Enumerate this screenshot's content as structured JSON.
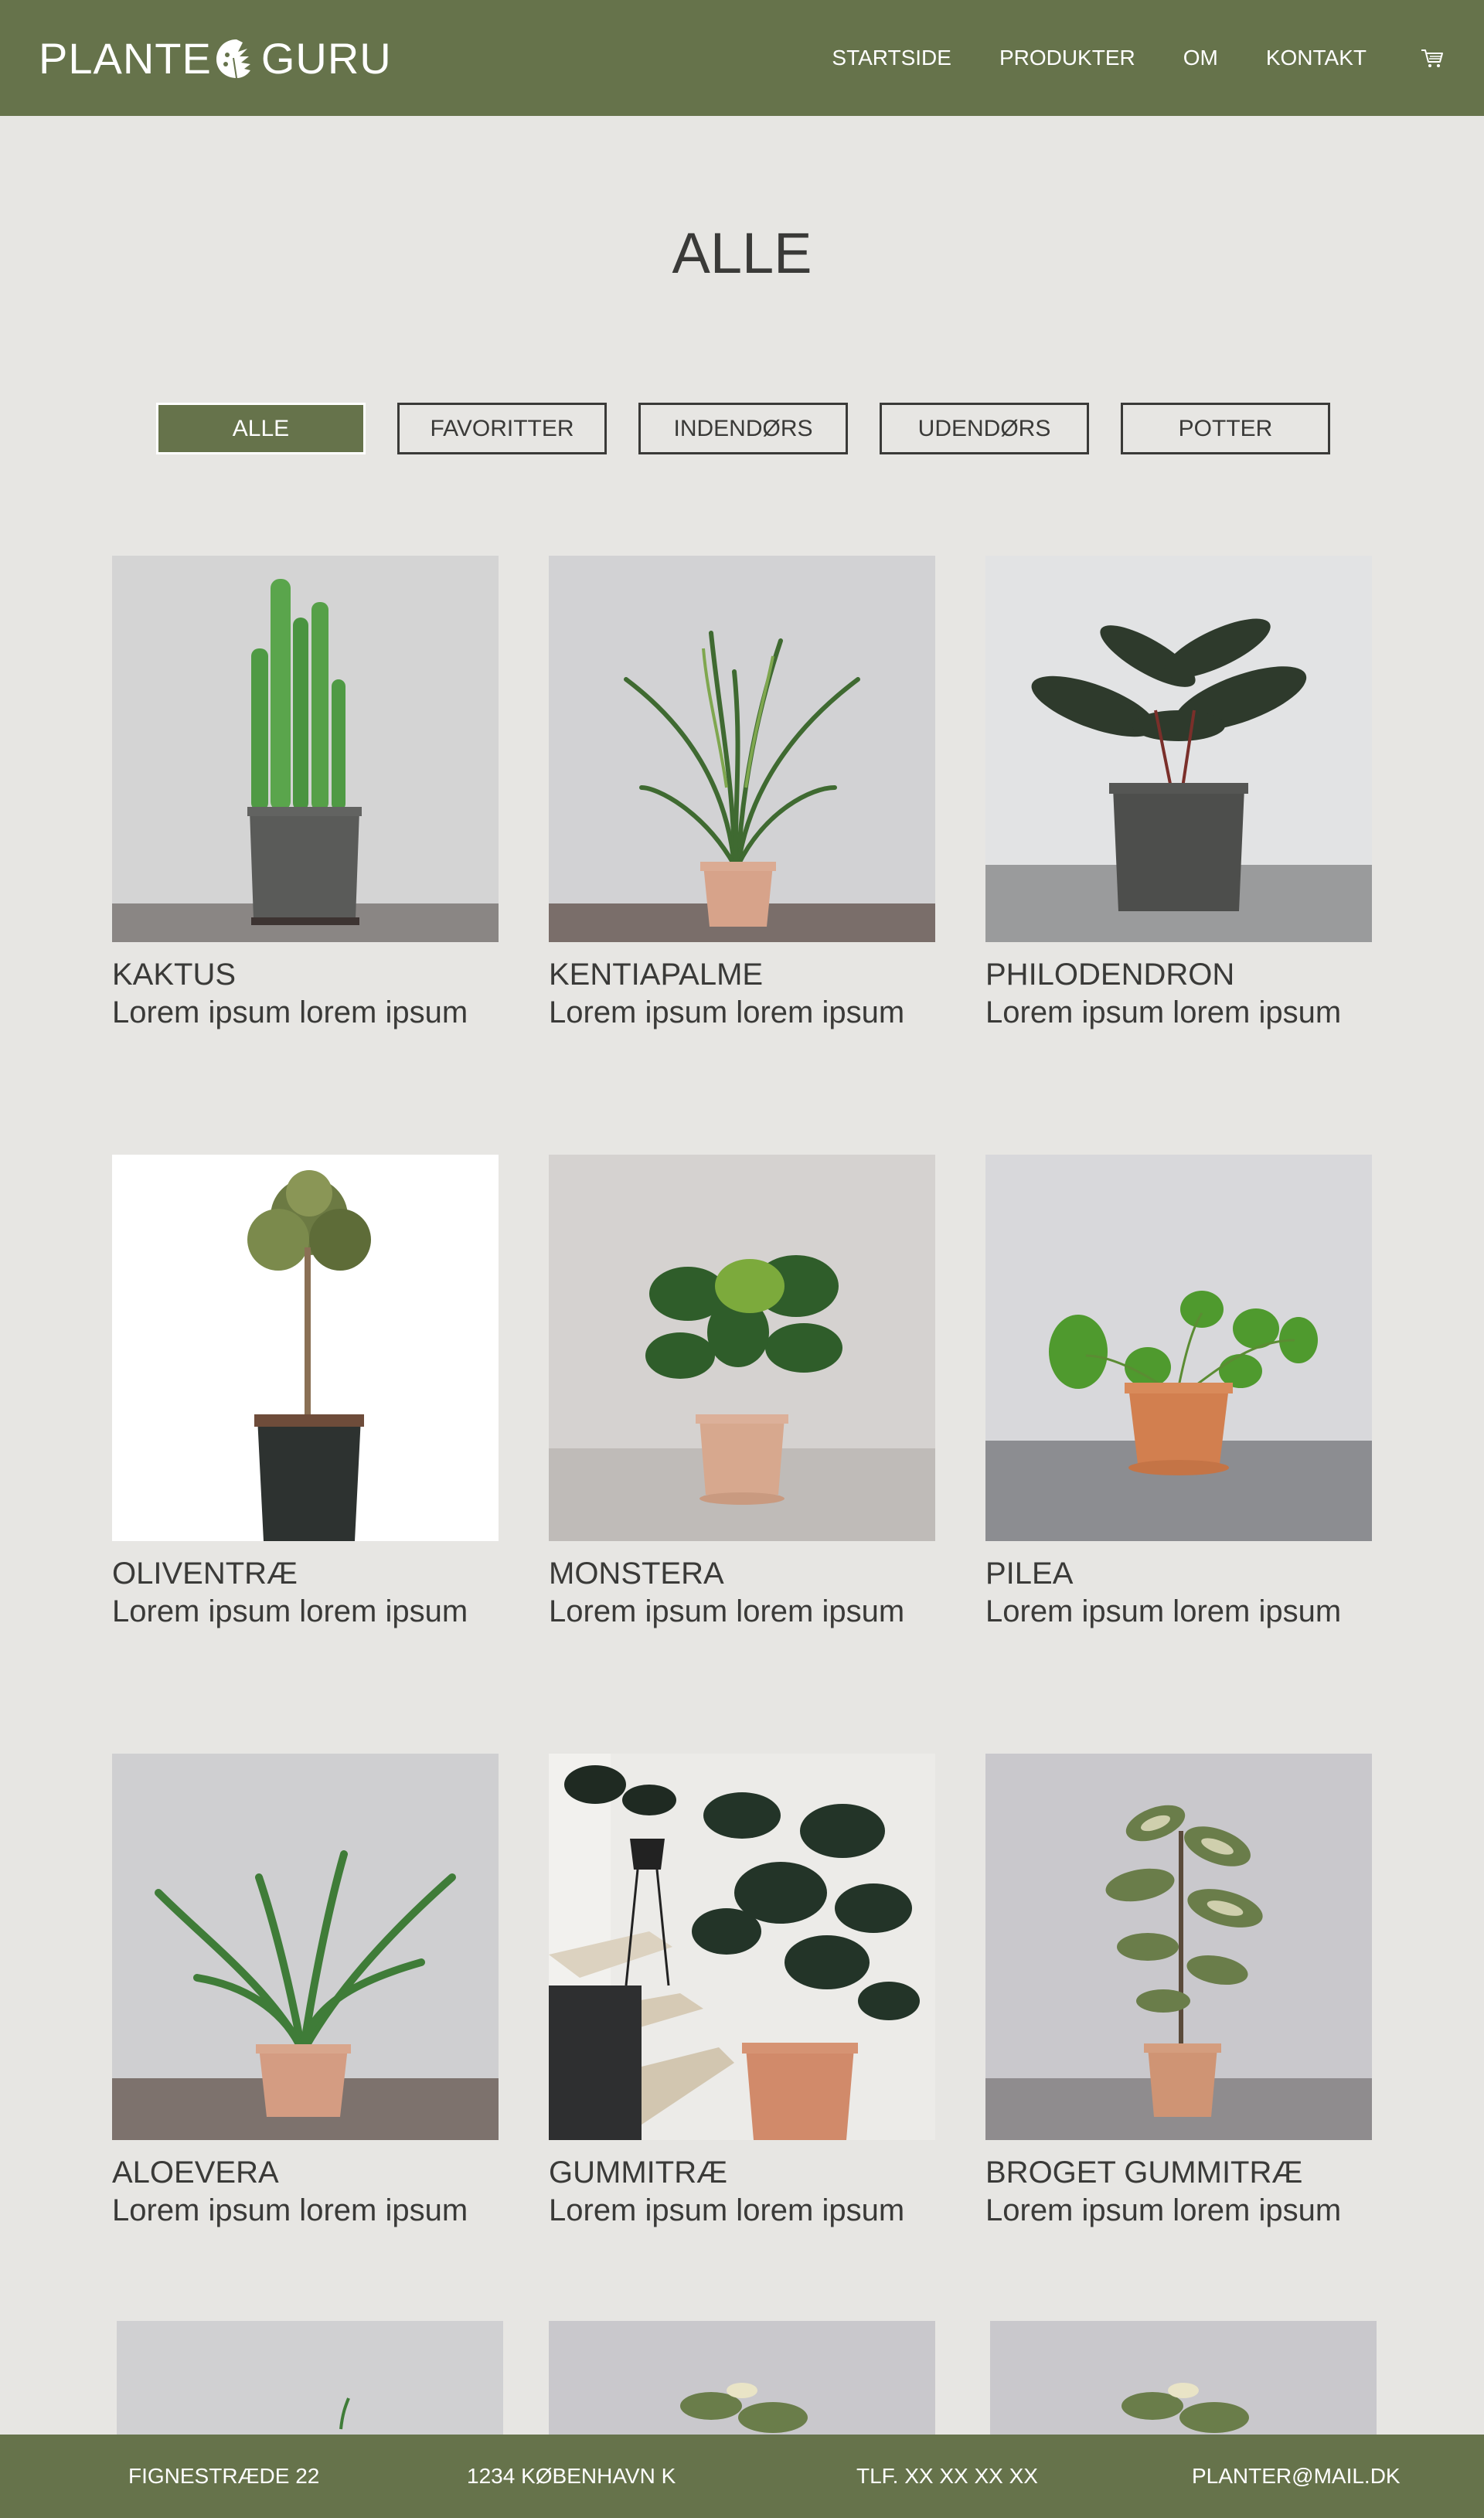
{
  "header": {
    "logo_left": "PLANTE",
    "logo_right": "GURU",
    "nav": [
      "STARTSIDE",
      "PRODUKTER",
      "OM",
      "KONTAKT"
    ],
    "cart_icon": "cart-icon",
    "bg": "#66734b"
  },
  "page_title": "ALLE",
  "filters": [
    "ALLE",
    "FAVORITTER",
    "INDENDØRS",
    "UDENDØRS",
    "POTTER"
  ],
  "active_filter": "ALLE",
  "products": [
    {
      "name": "KAKTUS",
      "desc": "Lorem ipsum lorem ipsum"
    },
    {
      "name": "KENTIAPALME",
      "desc": "Lorem ipsum lorem ipsum"
    },
    {
      "name": "PHILODENDRON",
      "desc": "Lorem ipsum lorem ipsum"
    },
    {
      "name": "OLIVENTRÆ",
      "desc": "Lorem ipsum lorem ipsum"
    },
    {
      "name": "MONSTERA",
      "desc": "Lorem ipsum lorem ipsum"
    },
    {
      "name": "PILEA",
      "desc": "Lorem ipsum lorem ipsum"
    },
    {
      "name": "ALOEVERA",
      "desc": "Lorem ipsum lorem ipsum"
    },
    {
      "name": "GUMMITRÆ",
      "desc": "Lorem ipsum lorem ipsum"
    },
    {
      "name": "BROGET GUMMITRÆ",
      "desc": "Lorem ipsum lorem ipsum"
    }
  ],
  "footer": {
    "address": "FIGNESTRÆDE 22",
    "city": "1234 KØBENHAVN K",
    "phone": "TLF. XX XX XX XX",
    "email": "PLANTER@MAIL.DK"
  },
  "colors": {
    "accent": "#66734b",
    "background": "#e7e6e3",
    "text": "#3a3a38"
  }
}
